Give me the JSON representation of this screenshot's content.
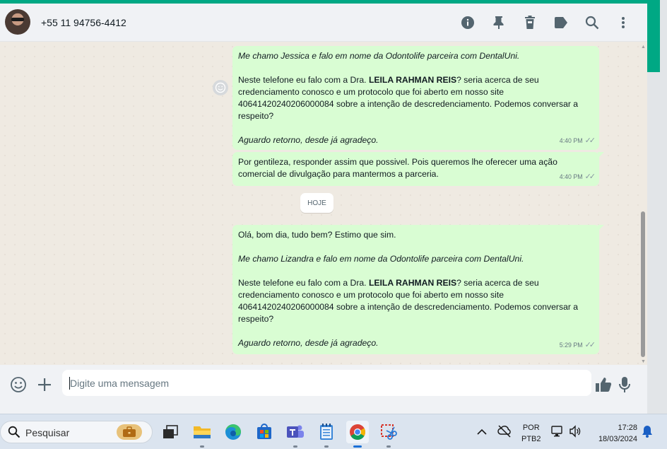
{
  "header": {
    "contact": "+55 11 94756-4412",
    "icons": [
      "info-icon",
      "pin-icon",
      "delete-icon",
      "label-icon",
      "search-icon",
      "menu-icon"
    ]
  },
  "messages": [
    {
      "paragraphs": [
        {
          "italic": true,
          "parts": [
            {
              "t": "Me chamo Jessica e falo em nome da Odontolife parceira com DentalUni.",
              "b": false
            }
          ]
        },
        {
          "italic": false,
          "parts": []
        },
        {
          "italic": false,
          "parts": [
            {
              "t": "Neste telefone eu falo com a Dra. ",
              "b": false
            },
            {
              "t": "LEILA RAHMAN REIS",
              "b": true
            },
            {
              "t": "? seria acerca de seu credenciamento conosco e um protocolo que foi aberto em nosso site 40641420240206000084 sobre a intenção de descredenciamento. Podemos conversar a respeito?",
              "b": false
            }
          ]
        },
        {
          "italic": false,
          "parts": []
        },
        {
          "italic": true,
          "parts": [
            {
              "t": "Aguardo retorno, desde já agradeço.",
              "b": false
            }
          ]
        }
      ],
      "time": "4:40 PM"
    },
    {
      "paragraphs": [
        {
          "italic": false,
          "parts": [
            {
              "t": "Por gentileza, responder assim que possivel. Pois queremos lhe oferecer uma ação comercial de divulgação para mantermos a parceria.",
              "b": false
            }
          ]
        }
      ],
      "time": "4:40 PM"
    },
    {
      "paragraphs": [
        {
          "italic": false,
          "parts": [
            {
              "t": "Olá, bom dia, tudo bem? Estimo que sim.",
              "b": false
            }
          ]
        },
        {
          "italic": false,
          "parts": []
        },
        {
          "italic": true,
          "parts": [
            {
              "t": "Me chamo Lizandra e falo em nome da Odontolife parceira com DentalUni.",
              "b": false
            }
          ]
        },
        {
          "italic": false,
          "parts": []
        },
        {
          "italic": false,
          "parts": [
            {
              "t": "Neste telefone eu falo com a Dra. ",
              "b": false
            },
            {
              "t": "LEILA RAHMAN REIS",
              "b": true
            },
            {
              "t": "? seria acerca de seu credenciamento conosco e um protocolo que foi aberto em nosso site 40641420240206000084 sobre a intenção de descredenciamento. Podemos conversar a respeito?",
              "b": false
            }
          ]
        },
        {
          "italic": false,
          "parts": []
        },
        {
          "italic": true,
          "parts": [
            {
              "t": "Aguardo retorno, desde já agradeço.",
              "b": false
            }
          ]
        }
      ],
      "time": "5:29 PM"
    }
  ],
  "date_divider": "HOJE",
  "composer": {
    "placeholder": "Digite uma mensagem"
  },
  "taskbar": {
    "search_text": "Pesquisar",
    "lang_line1": "POR",
    "lang_line2": "PTB2",
    "time": "17:28",
    "date": "18/03/2024"
  },
  "colors": {
    "accent": "#00a884",
    "bubble_out": "#d9fdd3",
    "chat_bg": "#efeae2",
    "header_bg": "#f0f2f5"
  }
}
